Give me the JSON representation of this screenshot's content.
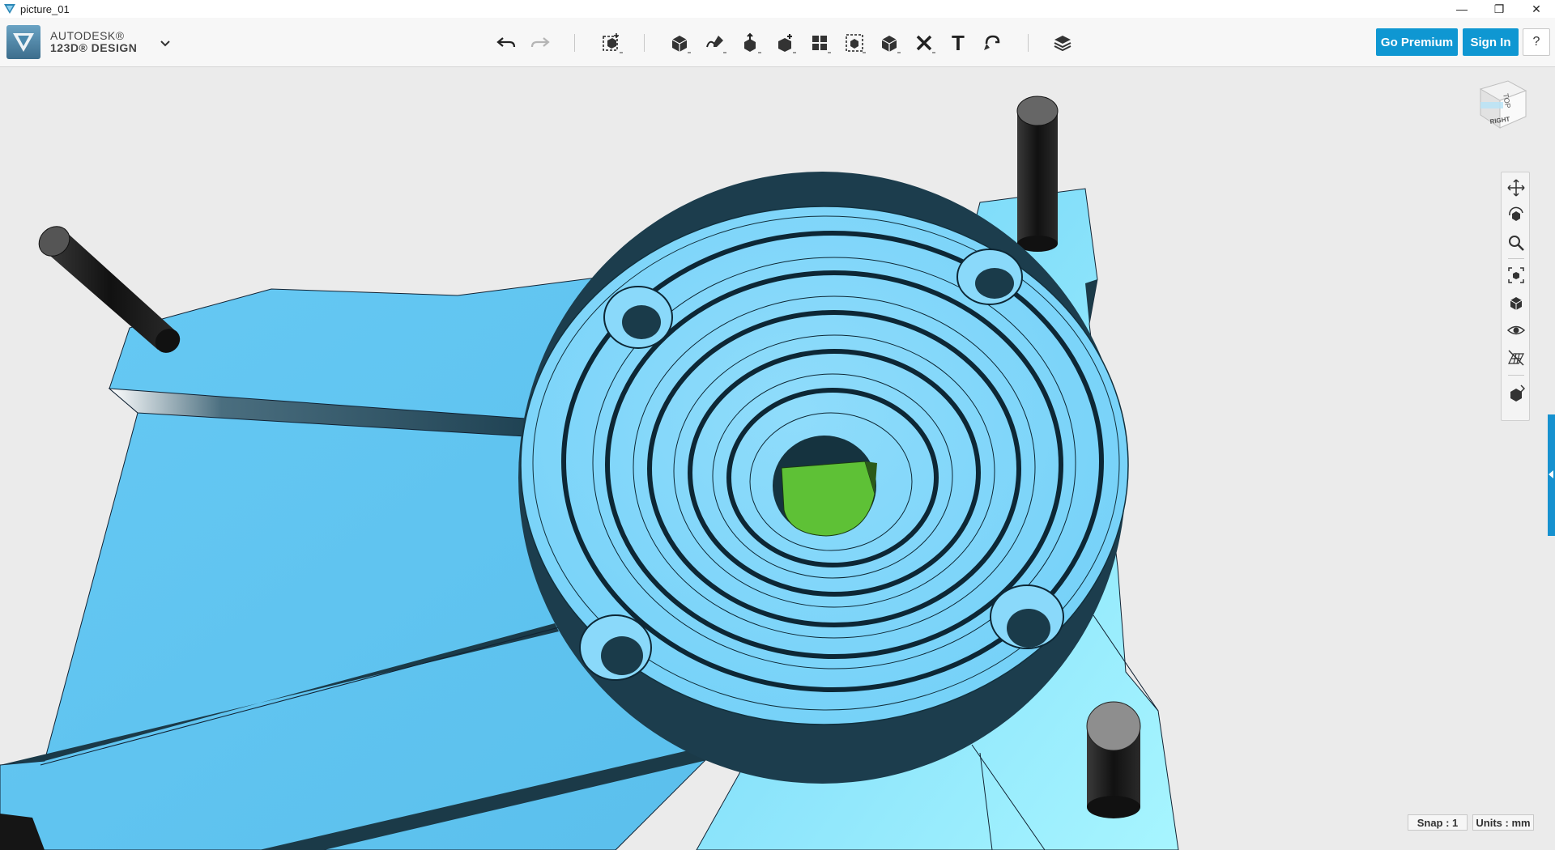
{
  "window": {
    "title": "picture_01",
    "minimize_glyph": "—",
    "restore_glyph": "❐",
    "close_glyph": "✕"
  },
  "brand": {
    "line1": "AUTODESK®",
    "line2": "123D® DESIGN",
    "menu_icon": "chevron-down-icon"
  },
  "toolbar": {
    "tools": [
      {
        "name": "undo-icon"
      },
      {
        "name": "redo-icon"
      },
      {
        "name": "transform-icon"
      },
      {
        "name": "primitives-icon"
      },
      {
        "name": "sketch-icon"
      },
      {
        "name": "construct-icon"
      },
      {
        "name": "modify-icon"
      },
      {
        "name": "pattern-icon"
      },
      {
        "name": "grouping-icon"
      },
      {
        "name": "combine-icon"
      },
      {
        "name": "measure-icon"
      },
      {
        "name": "text-icon"
      },
      {
        "name": "snap-icon"
      },
      {
        "name": "material-icon"
      }
    ],
    "text_tool_glyph": "T",
    "go_premium_label": "Go Premium",
    "sign_in_label": "Sign In",
    "help_label": "?"
  },
  "viewcube": {
    "top_label": "TOP",
    "right_label": "RIGHT"
  },
  "navbar": {
    "items": [
      "pan-icon",
      "orbit-icon",
      "zoom-icon",
      "fit-icon",
      "view-icon",
      "visibility-icon",
      "grid-icon",
      "material-visibility-icon"
    ]
  },
  "status": {
    "snap": "Snap : 1",
    "units": "Units : mm"
  },
  "colors": {
    "accent": "#0f97d2",
    "model_blue": "#6ccdf7",
    "model_dark": "#173a4a",
    "core_green": "#5ec136",
    "pin_black": "#1e1e1e"
  }
}
